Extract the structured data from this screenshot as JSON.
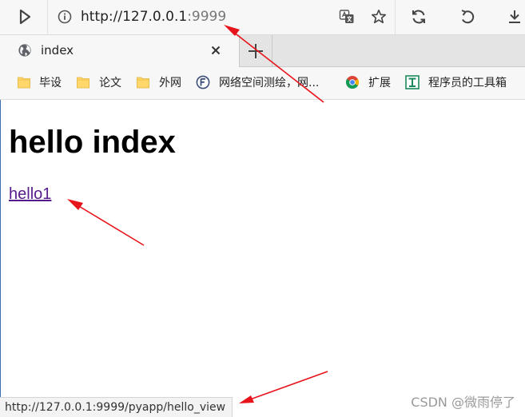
{
  "address_bar": {
    "url_host": "http://127.0.0.1",
    "url_port": ":9999"
  },
  "tab": {
    "title": "index"
  },
  "bookmarks": [
    {
      "label": "毕设",
      "icon": "folder-icon"
    },
    {
      "label": "论文",
      "icon": "folder-icon"
    },
    {
      "label": "外网",
      "icon": "folder-icon"
    },
    {
      "label": "网络空间测绘，网...",
      "icon": "fofa-icon"
    },
    {
      "label": "扩展",
      "icon": "chrome-icon"
    },
    {
      "label": "程序员的工具箱",
      "icon": "tool-icon"
    }
  ],
  "page": {
    "heading": "hello index",
    "link_text": "hello1"
  },
  "status_bar": {
    "url": "http://127.0.0.1:9999/pyapp/hello_view"
  },
  "watermark": "CSDN @微雨停了",
  "colors": {
    "link_visited": "#551a8b",
    "arrow": "#e8141b",
    "toolbar_bg": "#f7f7f7",
    "tabstrip_bg": "#e4e4e4"
  }
}
